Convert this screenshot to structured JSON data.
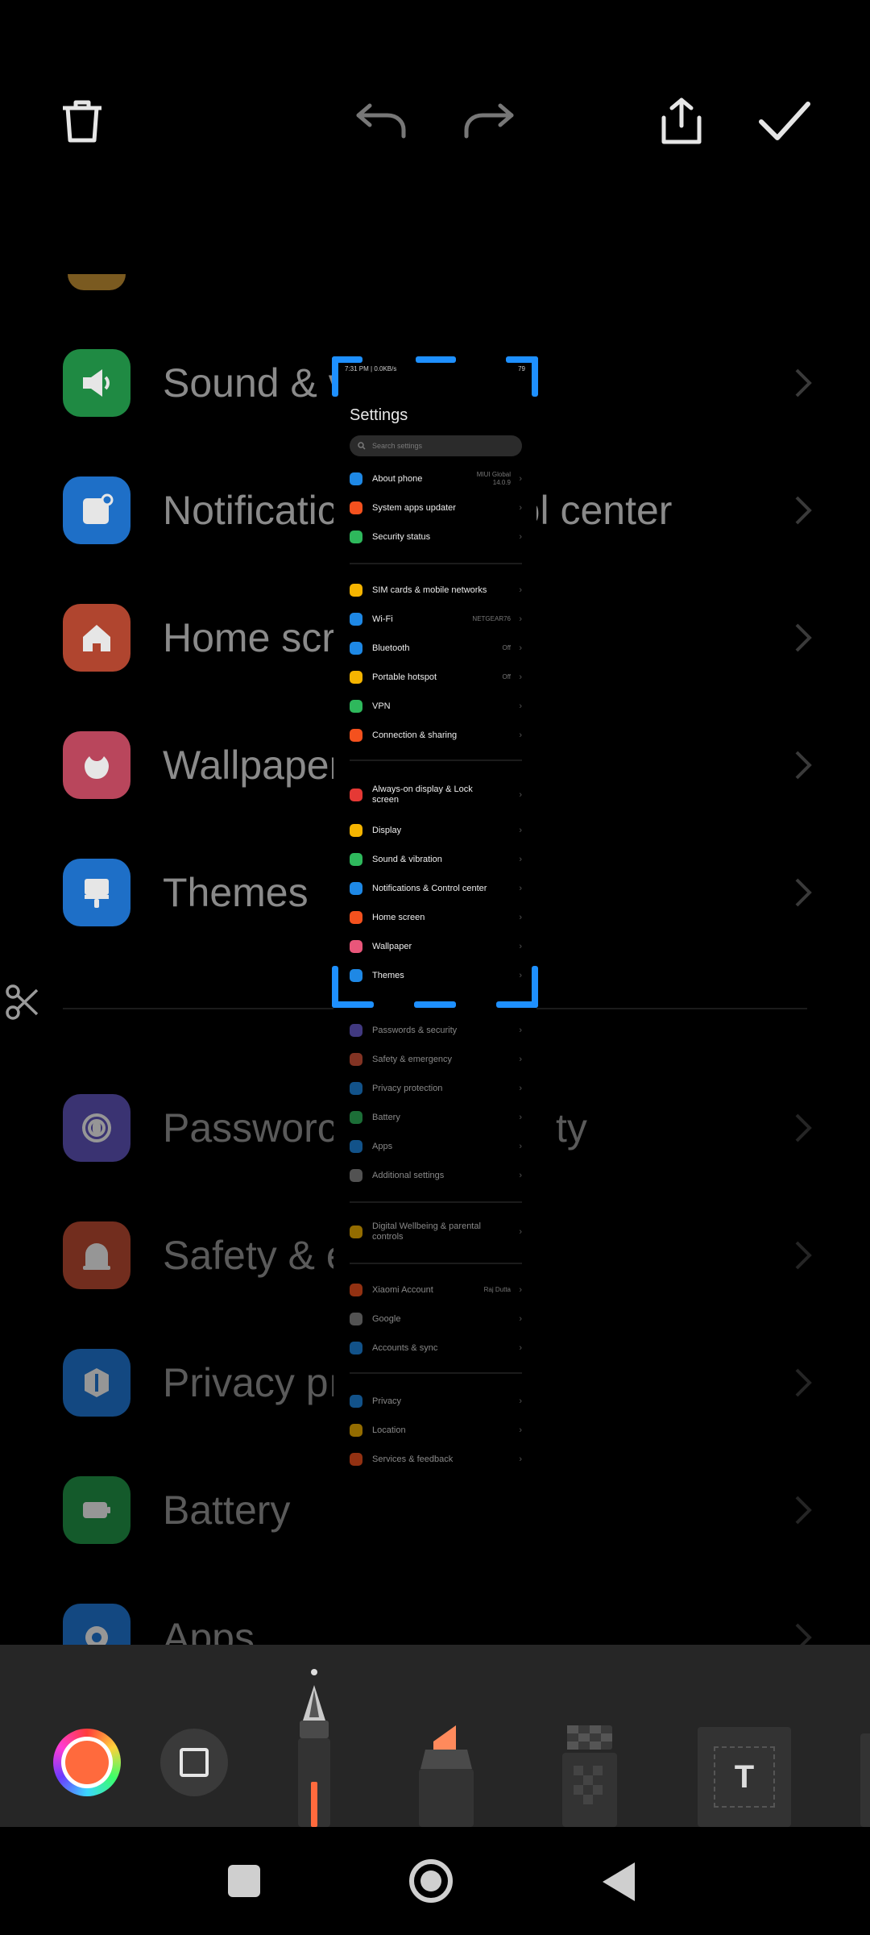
{
  "toolbar": {
    "delete": "trash-icon",
    "undo": "undo-icon",
    "redo": "redo-icon",
    "share": "share-icon",
    "done": "check-icon"
  },
  "background_list": {
    "items": [
      {
        "label": "Sound & v",
        "icon": "speaker-icon",
        "color": "#1f8a43"
      },
      {
        "label": "Notificatic",
        "suffix": "rol center",
        "icon": "notification-icon",
        "color": "#1e6fc7"
      },
      {
        "label": "Home scr",
        "icon": "home-icon",
        "color": "#b0452f"
      },
      {
        "label": "Wallpaper",
        "icon": "wallpaper-icon",
        "color": "#b9465c"
      },
      {
        "label": "Themes",
        "icon": "themes-icon",
        "color": "#1e6fc7"
      },
      {
        "label": "Passworc",
        "suffix": "ty",
        "icon": "password-icon",
        "color": "#5a4fb0"
      },
      {
        "label": "Safety & e",
        "icon": "safety-icon",
        "color": "#b0452f"
      },
      {
        "label": "Privacy pı",
        "icon": "privacy-icon",
        "color": "#1e6fc7"
      },
      {
        "label": "Battery",
        "icon": "battery-icon",
        "color": "#1f8a43"
      },
      {
        "label": "Apps",
        "icon": "apps-icon",
        "color": "#1e6fc7"
      }
    ]
  },
  "mini": {
    "status_left": "7:31 PM | 0.0KB/s",
    "status_right": "79",
    "title": "Settings",
    "search_placeholder": "Search settings",
    "rows": [
      {
        "label": "About phone",
        "value": "MIUI Global\n14.0.9",
        "color": "#1e88e5"
      },
      {
        "label": "System apps updater",
        "value": "",
        "color": "#f4511e"
      },
      {
        "label": "Security status",
        "value": "",
        "color": "#2eb85c"
      },
      {
        "label": "SIM cards & mobile networks",
        "value": "",
        "color": "#f5b400"
      },
      {
        "label": "Wi-Fi",
        "value": "NETGEAR76",
        "color": "#1e88e5"
      },
      {
        "label": "Bluetooth",
        "value": "Off",
        "color": "#1e88e5"
      },
      {
        "label": "Portable hotspot",
        "value": "Off",
        "color": "#f5b400"
      },
      {
        "label": "VPN",
        "value": "",
        "color": "#2eb85c"
      },
      {
        "label": "Connection & sharing",
        "value": "",
        "color": "#f4511e"
      },
      {
        "label": "Always-on display & Lock screen",
        "value": "",
        "color": "#e53935"
      },
      {
        "label": "Display",
        "value": "",
        "color": "#f5b400"
      },
      {
        "label": "Sound & vibration",
        "value": "",
        "color": "#2eb85c"
      },
      {
        "label": "Notifications & Control center",
        "value": "",
        "color": "#1e88e5"
      },
      {
        "label": "Home screen",
        "value": "",
        "color": "#f4511e"
      },
      {
        "label": "Wallpaper",
        "value": "",
        "color": "#e9567a"
      },
      {
        "label": "Themes",
        "value": "",
        "color": "#1e88e5"
      },
      {
        "label": "Passwords & security",
        "value": "",
        "color": "#6d5fd6"
      },
      {
        "label": "Safety & emergency",
        "value": "",
        "color": "#d8553a"
      },
      {
        "label": "Privacy protection",
        "value": "",
        "color": "#1e88e5"
      },
      {
        "label": "Battery",
        "value": "",
        "color": "#2eb85c"
      },
      {
        "label": "Apps",
        "value": "",
        "color": "#1e88e5"
      },
      {
        "label": "Additional settings",
        "value": "",
        "color": "#888888"
      },
      {
        "label": "Digital Wellbeing & parental controls",
        "value": "",
        "color": "#f5b400"
      },
      {
        "label": "Xiaomi Account",
        "value": "Raj Dutta",
        "color": "#f4511e"
      },
      {
        "label": "Google",
        "value": "",
        "color": "#888888"
      },
      {
        "label": "Accounts & sync",
        "value": "",
        "color": "#1e88e5"
      },
      {
        "label": "Privacy",
        "value": "",
        "color": "#1e88e5"
      },
      {
        "label": "Location",
        "value": "",
        "color": "#f5b400"
      },
      {
        "label": "Services & feedback",
        "value": "",
        "color": "#f4511e"
      }
    ]
  },
  "tools": {
    "color_picker": "color-wheel-icon",
    "shape": "square-shape-icon",
    "pen": "pen-tool",
    "highlighter": "highlighter-tool",
    "mosaic": "mosaic-tool",
    "text": "T"
  },
  "side": {
    "scissors": "scissors-icon"
  },
  "nav": {
    "recents": "recents-icon",
    "home": "home-circle-icon",
    "back": "back-icon"
  },
  "colors": {
    "accent": "#1e90ff",
    "brush": "#ff6a3d",
    "tray": "#262626"
  }
}
